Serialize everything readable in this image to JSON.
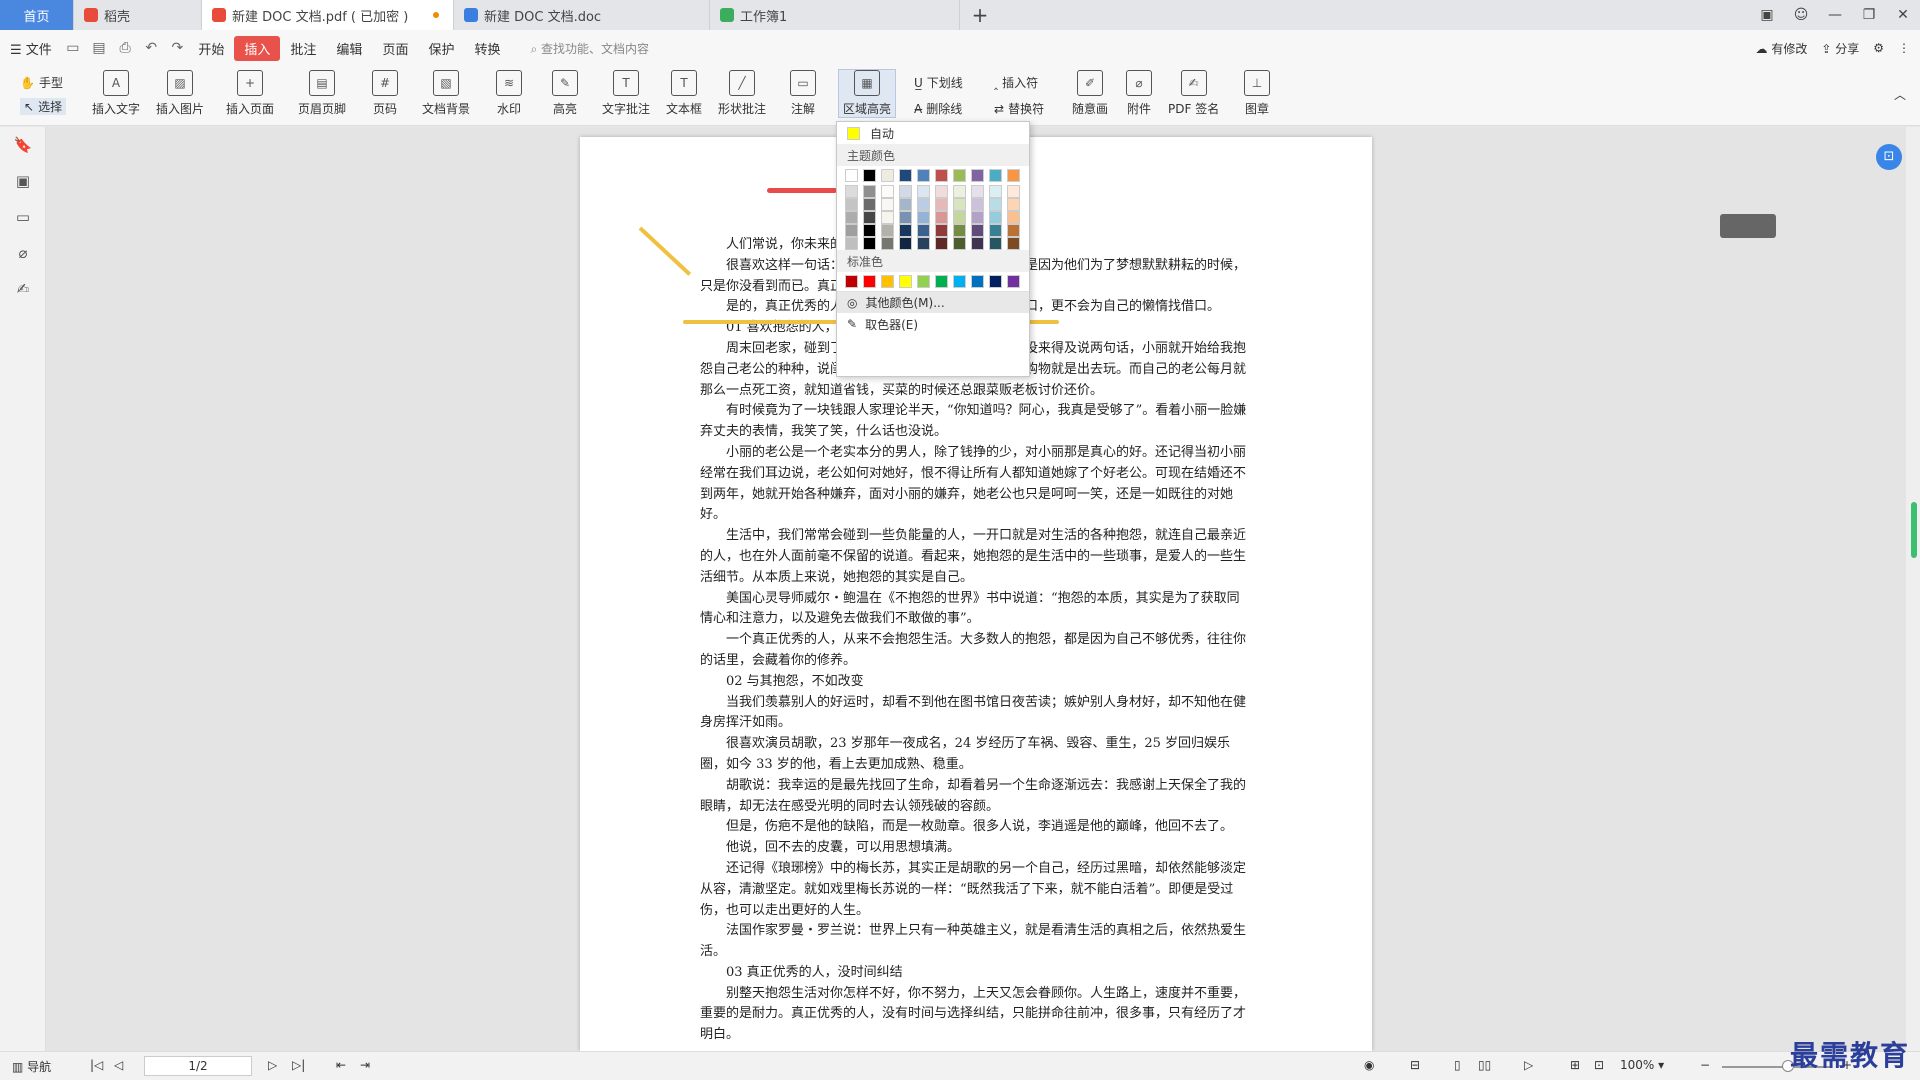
{
  "tabs": [
    {
      "label": "首页"
    },
    {
      "label": "稻壳"
    },
    {
      "label": "新建 DOC 文档.pdf ( 已加密 )"
    },
    {
      "label": "新建 DOC 文档.doc"
    },
    {
      "label": "工作簿1"
    }
  ],
  "menubar": {
    "file": "文件",
    "items": [
      "开始",
      "插入",
      "批注",
      "编辑",
      "页面",
      "保护",
      "转换"
    ],
    "active": "插入",
    "search_placeholder": "查找功能、文档内容",
    "right": [
      "有修改",
      "分享"
    ]
  },
  "ribbon": {
    "hand": "手型",
    "select": "选择",
    "buttons": [
      "插入文字",
      "插入图片",
      "插入页面",
      "页眉页脚",
      "页码",
      "文档背景",
      "水印",
      "高亮",
      "文字批注",
      "文本框",
      "形状批注",
      "注解",
      "区域高亮",
      "随意画",
      "附件",
      "PDF 签名",
      "图章"
    ],
    "small": [
      "下划线",
      "插入符",
      "删除线",
      "替换符"
    ]
  },
  "dropdown": {
    "auto": "自动",
    "theme_colors": "主题颜色",
    "standard_colors": "标准色",
    "more_colors": "其他颜色(M)...",
    "picker": "取色器(E)",
    "theme_row": [
      "#ffffff",
      "#000000",
      "#eeece1",
      "#1f497d",
      "#4f81bd",
      "#c0504d",
      "#9bbb59",
      "#8064a2",
      "#4bacc6",
      "#f79646"
    ],
    "standard_row": [
      "#c00000",
      "#ff0000",
      "#ffc000",
      "#ffff00",
      "#92d050",
      "#00b050",
      "#00b0f0",
      "#0070c0",
      "#002060",
      "#7030a0"
    ]
  },
  "document": {
    "paragraphs": [
      "人们常说，你未来的样子，藏在你现在的努力里。",
      "很喜欢这样一句话：不是所有的人都能坚持到最后，是因为他们为了梦想默默耕耘的时候，只是你没看到而已。真正优秀的人",
      "是的，真正优秀的人，从来不会为自己的失败寻找借口，更不会为自己的懒惰找借口。",
      "01 喜欢抱怨的人，",
      "周末回老家，碰到了许久未见的小丽，寒暄之后，还没来得及说两句话，小丽就开始给我抱怨自己老公的种种，说闺蜜的老公有多好，闺蜜每天除了购物就是出去玩。而自己的老公每月就那么一点死工资，就知道省钱，买菜的时候还总跟菜贩老板讨价还价。",
      "有时候竟为了一块钱跟人家理论半天，“你知道吗？阿心，我真是受够了”。看着小丽一脸嫌弃丈夫的表情，我笑了笑，什么话也没说。",
      "小丽的老公是一个老实本分的男人，除了钱挣的少，对小丽那是真心的好。还记得当初小丽经常在我们耳边说，老公如何对她好，恨不得让所有人都知道她嫁了个好老公。可现在结婚还不到两年，她就开始各种嫌弃，面对小丽的嫌弃，她老公也只是呵呵一笑，还是一如既往的对她好。",
      "生活中，我们常常会碰到一些负能量的人，一开口就是对生活的各种抱怨，就连自己最亲近的人，也在外人面前毫不保留的说道。看起来，她抱怨的是生活中的一些琐事，是爱人的一些生活细节。从本质上来说，她抱怨的其实是自己。",
      "美国心灵导师威尔・鲍温在《不抱怨的世界》书中说道：“抱怨的本质，其实是为了获取同情心和注意力，以及避免去做我们不敢做的事”。",
      "一个真正优秀的人，从来不会抱怨生活。大多数人的抱怨，都是因为自己不够优秀，往往你的话里，会藏着你的修养。",
      "02 与其抱怨，不如改变",
      "当我们羡慕别人的好运时，却看不到他在图书馆日夜苦读；嫉妒别人身材好，却不知他在健身房挥汗如雨。",
      "很喜欢演员胡歌，23 岁那年一夜成名，24 岁经历了车祸、毁容、重生，25 岁回归娱乐圈，如今 33 岁的他，看上去更加成熟、稳重。",
      "胡歌说：我幸运的是最先找回了生命，却看着另一个生命逐渐远去：我感谢上天保全了我的眼睛，却无法在感受光明的同时去认领残破的容颜。",
      "但是，伤疤不是他的缺陷，而是一枚勋章。很多人说，李逍遥是他的巅峰，他回不去了。",
      "他说，回不去的皮囊，可以用思想填满。",
      "还记得《琅琊榜》中的梅长苏，其实正是胡歌的另一个自己，经历过黑暗，却依然能够淡定从容，清澈坚定。就如戏里梅长苏说的一样：“既然我活了下来，就不能白活着”。即便是受过伤，也可以走出更好的人生。",
      "法国作家罗曼・罗兰说：世界上只有一种英雄主义，就是看清生活的真相之后，依然热爱生活。",
      "03 真正优秀的人，没时间纠结",
      "别整天抱怨生活对你怎样不好，你不努力，上天又怎会眷顾你。人生路上，速度并不重要，重要的是耐力。真正优秀的人，没有时间与选择纠结，只能拼命往前冲，很多事，只有经历了才明白。"
    ]
  },
  "status": {
    "nav": "导航",
    "page": "1/2",
    "zoom": "100%"
  },
  "watermark": "最需教育"
}
